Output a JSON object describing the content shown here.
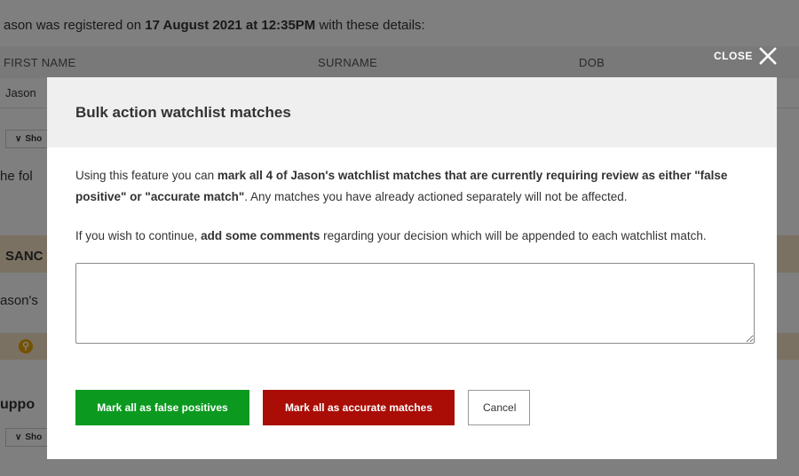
{
  "background": {
    "registration_prefix": "ason was registered on ",
    "registration_date": "17 August 2021 at 12:35PM",
    "registration_suffix": " with these details:",
    "col_first_name": "FIRST NAME",
    "col_surname": "SURNAME",
    "col_dob": "DOB",
    "first_name_value": "Jason",
    "show_link_label": "Sho",
    "following_text": "he fol",
    "sanctions_label": "SANC",
    "jasons_text": "ason's",
    "support_label": "uppo",
    "show_link_label_2": "Sho"
  },
  "close": {
    "label": "CLOSE"
  },
  "modal": {
    "title": "Bulk action watchlist matches",
    "para1_a": "Using this feature you can ",
    "para1_b": "mark all 4 of Jason's watchlist matches that are currently requiring review as either \"false positive\" or \"accurate match\"",
    "para1_c": ". Any matches you have already actioned separately will not be affected.",
    "para2_a": "If you wish to continue, ",
    "para2_b": "add some comments",
    "para2_c": " regarding your decision which will be appended to each watchlist match.",
    "comment_value": "",
    "btn_false_positive": "Mark all as false positives",
    "btn_accurate": "Mark all as accurate matches",
    "btn_cancel": "Cancel"
  },
  "colors": {
    "overlay": "#000000",
    "green_button": "#0b9a1f",
    "red_button": "#a90d06",
    "sanctions_bar": "#f6e3c4",
    "modal_header": "#efefef"
  }
}
